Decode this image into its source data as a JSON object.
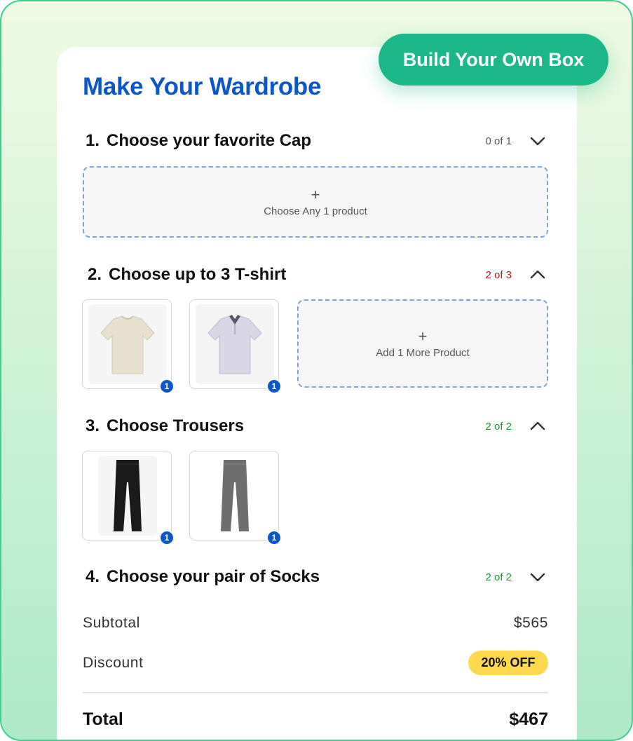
{
  "badge": {
    "label": "Build Your Own Box"
  },
  "title": "Make Your Wardrobe",
  "sections": [
    {
      "number": "1.",
      "title": "Choose your favorite Cap",
      "count": "0 of 1",
      "count_color": "#555555",
      "expanded": false,
      "empty_slot": {
        "plus": "+",
        "label": "Choose Any 1 product"
      }
    },
    {
      "number": "2.",
      "title": "Choose up to 3 T-shirt",
      "count": "2 of 3",
      "count_color": "#c0161d",
      "expanded": true,
      "items": [
        {
          "name": "beige-tshirt",
          "qty": "1"
        },
        {
          "name": "lilac-polo-shirt",
          "qty": "1"
        }
      ],
      "add_slot": {
        "plus": "+",
        "label": "Add 1 More Product"
      }
    },
    {
      "number": "3.",
      "title": "Choose Trousers",
      "count": "2 of 2",
      "count_color": "#1c9a2e",
      "expanded": true,
      "items": [
        {
          "name": "black-trousers",
          "qty": "1"
        },
        {
          "name": "grey-trousers",
          "qty": "1"
        }
      ]
    },
    {
      "number": "4.",
      "title": "Choose your pair of Socks",
      "count": "2 of 2",
      "count_color": "#1c9a2e",
      "expanded": false
    }
  ],
  "summary": {
    "subtotal_label": "Subtotal",
    "subtotal_value": "$565",
    "discount_label": "Discount",
    "discount_value": "20% OFF",
    "total_label": "Total",
    "total_value": "$467"
  },
  "colors": {
    "brand": "#0d56c8",
    "accent": "#1cb889",
    "discount": "#ffd84d"
  }
}
